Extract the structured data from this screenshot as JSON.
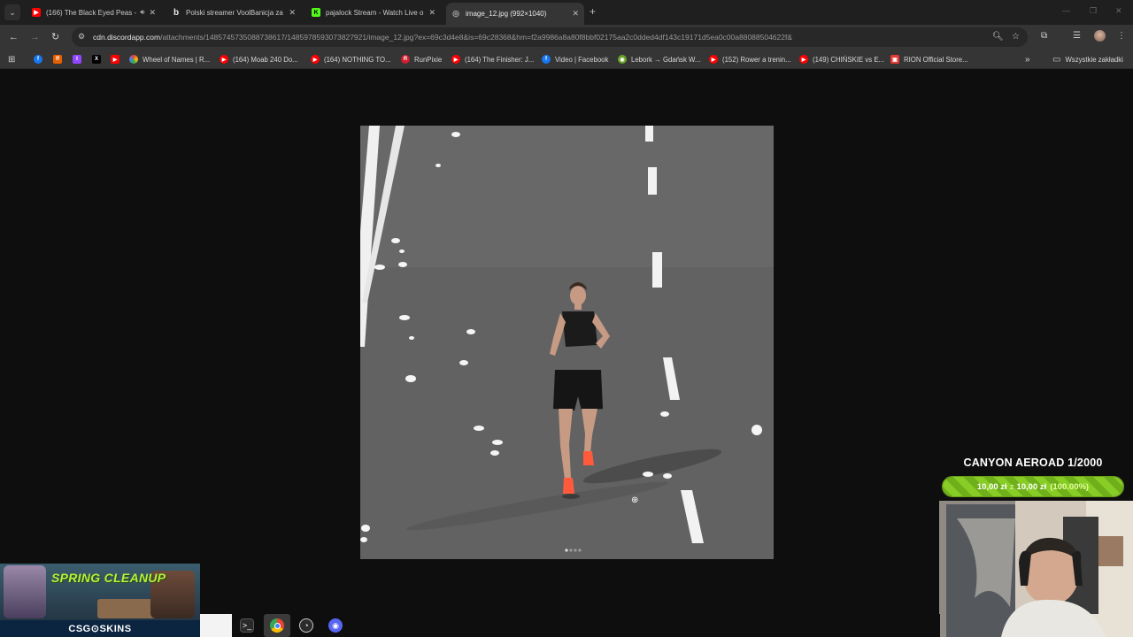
{
  "browser": {
    "tabs": [
      {
        "title": "(166) The Black Eyed Peas -",
        "favicon": "youtube-icon",
        "audio": true,
        "active": false
      },
      {
        "title": "Polski streamer VoolBanicja za",
        "favicon": "bing-icon",
        "audio": false,
        "active": false
      },
      {
        "title": "pajalock Stream - Watch Live o",
        "favicon": "kick-icon",
        "audio": false,
        "active": false
      },
      {
        "title": "image_12.jpg (992×1040)",
        "favicon": "globe-icon",
        "audio": false,
        "active": true
      }
    ],
    "address": {
      "host": "cdn.discordapp.com",
      "path": "/attachments/1485745735088738617/1485978593073827921/image_12.jpg?ex=69c3d4e8&is=69c28368&hm=f2a9986a8a80f8bbf02175aa2c0dded4df143c19171d5ea0c00a88088504622f&"
    },
    "bookmarks": [
      {
        "label": "",
        "icon": "facebook-icon",
        "color": "#1877f2"
      },
      {
        "label": "",
        "icon": "firefox-icon",
        "color": "#e66000"
      },
      {
        "label": "",
        "icon": "twitch-icon",
        "color": "#9146ff"
      },
      {
        "label": "",
        "icon": "x-icon",
        "color": "#000000"
      },
      {
        "label": "",
        "icon": "youtube-icon",
        "color": "#ff0000"
      },
      {
        "label": "Wheel of Names | R...",
        "icon": "google-icon",
        "color": "#4285f4"
      },
      {
        "label": "(164) Moab 240 Do...",
        "icon": "youtube-icon",
        "color": "#ff0000"
      },
      {
        "label": "(164) NOTHING TO...",
        "icon": "youtube-icon",
        "color": "#ff0000"
      },
      {
        "label": "RunPixie",
        "icon": "runpixie-icon",
        "color": "#d01f2f"
      },
      {
        "label": "(164) The Finisher: J...",
        "icon": "youtube-icon",
        "color": "#ff0000"
      },
      {
        "label": "Video | Facebook",
        "icon": "facebook-icon",
        "color": "#1877f2"
      },
      {
        "label": "Lebork → Gdańsk W...",
        "icon": "komoot-icon",
        "color": "#6aa127"
      },
      {
        "label": "(152) Rower a trenin...",
        "icon": "youtube-icon",
        "color": "#ff0000"
      },
      {
        "label": "(149) CHIŃSKIE vs E...",
        "icon": "youtube-icon",
        "color": "#ff0000"
      },
      {
        "label": "RION Official Store...",
        "icon": "store-icon",
        "color": "#e53935"
      }
    ],
    "all_bookmarks": "Wszystkie zakładki"
  },
  "goal": {
    "title": "CANYON AEROAD 1/2000",
    "current": "10,00 zł",
    "separator": "z",
    "target": "10,00 zł",
    "percent_text": "(100.00%)",
    "progress": 1.0
  },
  "overlay": {
    "banner": "SPRING CLEANUP",
    "brand": "CSG⊙SKINS"
  },
  "taskbar": [
    "terminal-icon",
    "chrome-icon",
    "clock-icon",
    "discord-icon"
  ],
  "colors": {
    "accent_green": "#7bbd1f",
    "viewer_bg": "#0e0e0e",
    "toolbar_bg": "#353535"
  }
}
